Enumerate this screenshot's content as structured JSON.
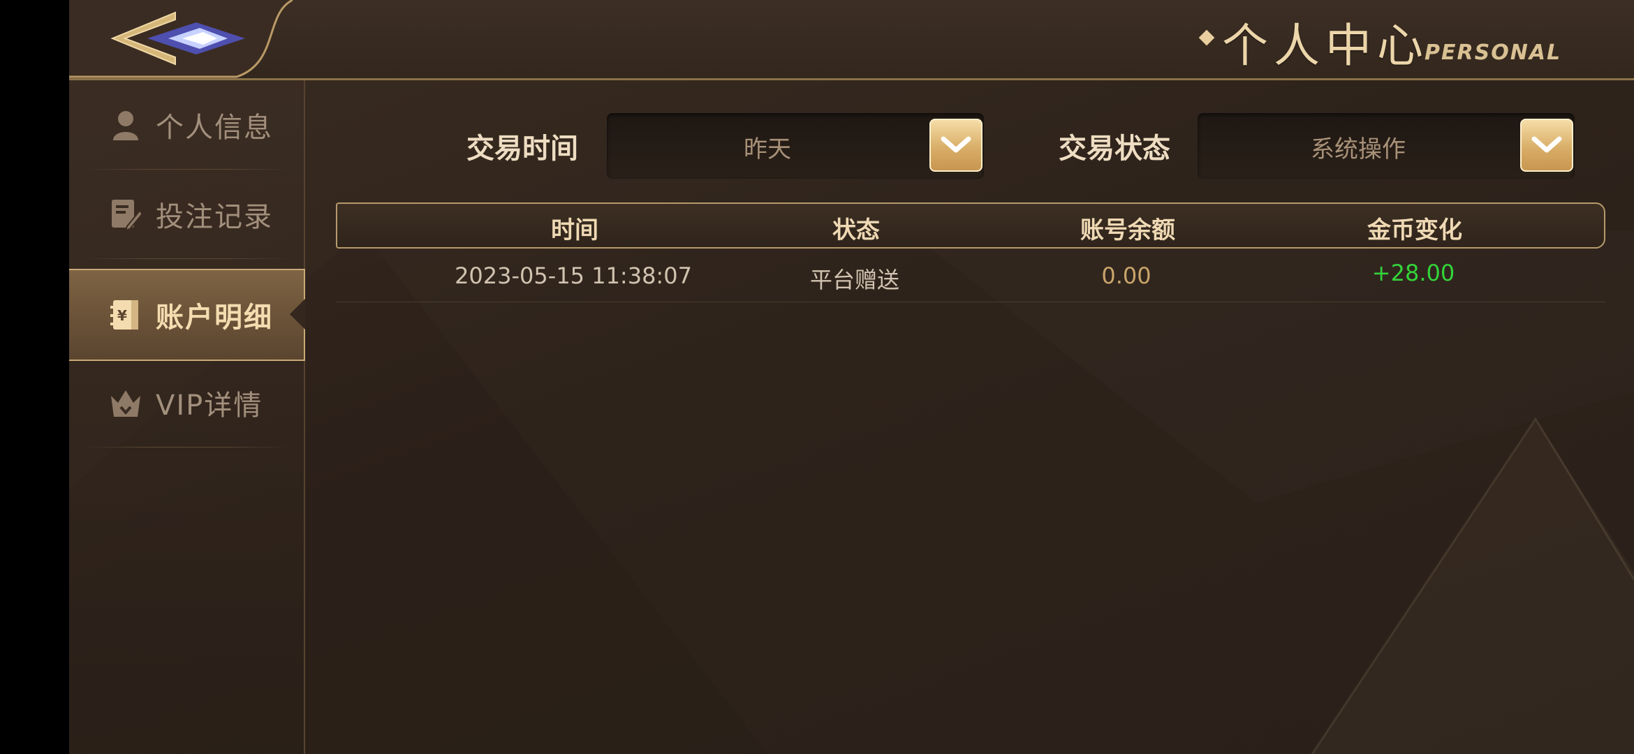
{
  "header": {
    "title": "个人中心",
    "title_en": "PERSONAL",
    "back_icon": "back-arrow-icon"
  },
  "sidebar": {
    "items": [
      {
        "label": "个人信息",
        "icon": "user-icon",
        "active": false
      },
      {
        "label": "投注记录",
        "icon": "edit-record-icon",
        "active": false
      },
      {
        "label": "账户明细",
        "icon": "ledger-icon",
        "active": true
      },
      {
        "label": "VIP详情",
        "icon": "crown-icon",
        "active": false
      }
    ]
  },
  "filters": {
    "time": {
      "label": "交易时间",
      "value": "昨天"
    },
    "status": {
      "label": "交易状态",
      "value": "系统操作"
    }
  },
  "table": {
    "headers": [
      "时间",
      "状态",
      "账号余额",
      "金币变化"
    ],
    "rows": [
      {
        "time": "2023-05-15 11:38:07",
        "status": "平台赠送",
        "balance": "0.00",
        "change": "+28.00"
      }
    ]
  },
  "colors": {
    "accent_gold": "#d9ae68",
    "positive_green": "#33d33a",
    "balance_gold": "#c9a56a"
  }
}
